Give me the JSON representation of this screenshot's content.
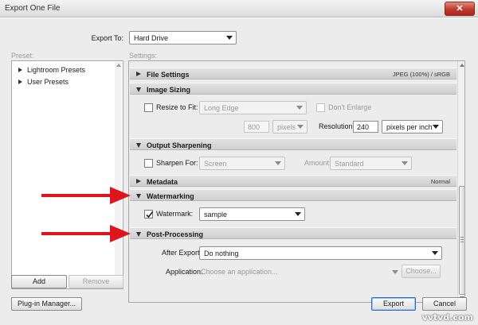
{
  "window": {
    "title": "Export One File",
    "close_glyph": "✕"
  },
  "header": {
    "export_to_label": "Export To:",
    "export_to_value": "Hard Drive"
  },
  "preset": {
    "label": "Preset:",
    "items": [
      "Lightroom Presets",
      "User Presets"
    ],
    "add_label": "Add",
    "remove_label": "Remove"
  },
  "settings": {
    "label": "Settings:",
    "file_settings": {
      "title": "File Settings",
      "summary": "JPEG (100%) / sRGB"
    },
    "image_sizing": {
      "title": "Image Sizing",
      "resize_label": "Resize to Fit:",
      "resize_mode": "Long Edge",
      "dont_enlarge_label": "Don't Enlarge",
      "size_value": "800",
      "size_units": "pixels",
      "resolution_label": "Resolution:",
      "resolution_value": "240",
      "resolution_units": "pixels per inch"
    },
    "output_sharpening": {
      "title": "Output Sharpening",
      "sharpen_label": "Sharpen For:",
      "sharpen_value": "Screen",
      "amount_label": "Amount:",
      "amount_value": "Standard"
    },
    "metadata": {
      "title": "Metadata",
      "summary": "Normal"
    },
    "watermarking": {
      "title": "Watermarking",
      "watermark_label": "Watermark:",
      "watermark_value": "sample",
      "checked": true
    },
    "post_processing": {
      "title": "Post-Processing",
      "after_export_label": "After Export:",
      "after_export_value": "Do nothing",
      "application_label": "Application:",
      "application_placeholder": "Choose an application...",
      "choose_label": "Choose..."
    }
  },
  "footer": {
    "plugin_manager_label": "Plug-in Manager...",
    "export_label": "Export",
    "cancel_label": "Cancel"
  },
  "watermark_text": "vvtvd.com",
  "colors": {
    "annotation_arrow": "#e0141b",
    "default_button_border": "#2c6fc0",
    "close_button": "#c0392b"
  }
}
